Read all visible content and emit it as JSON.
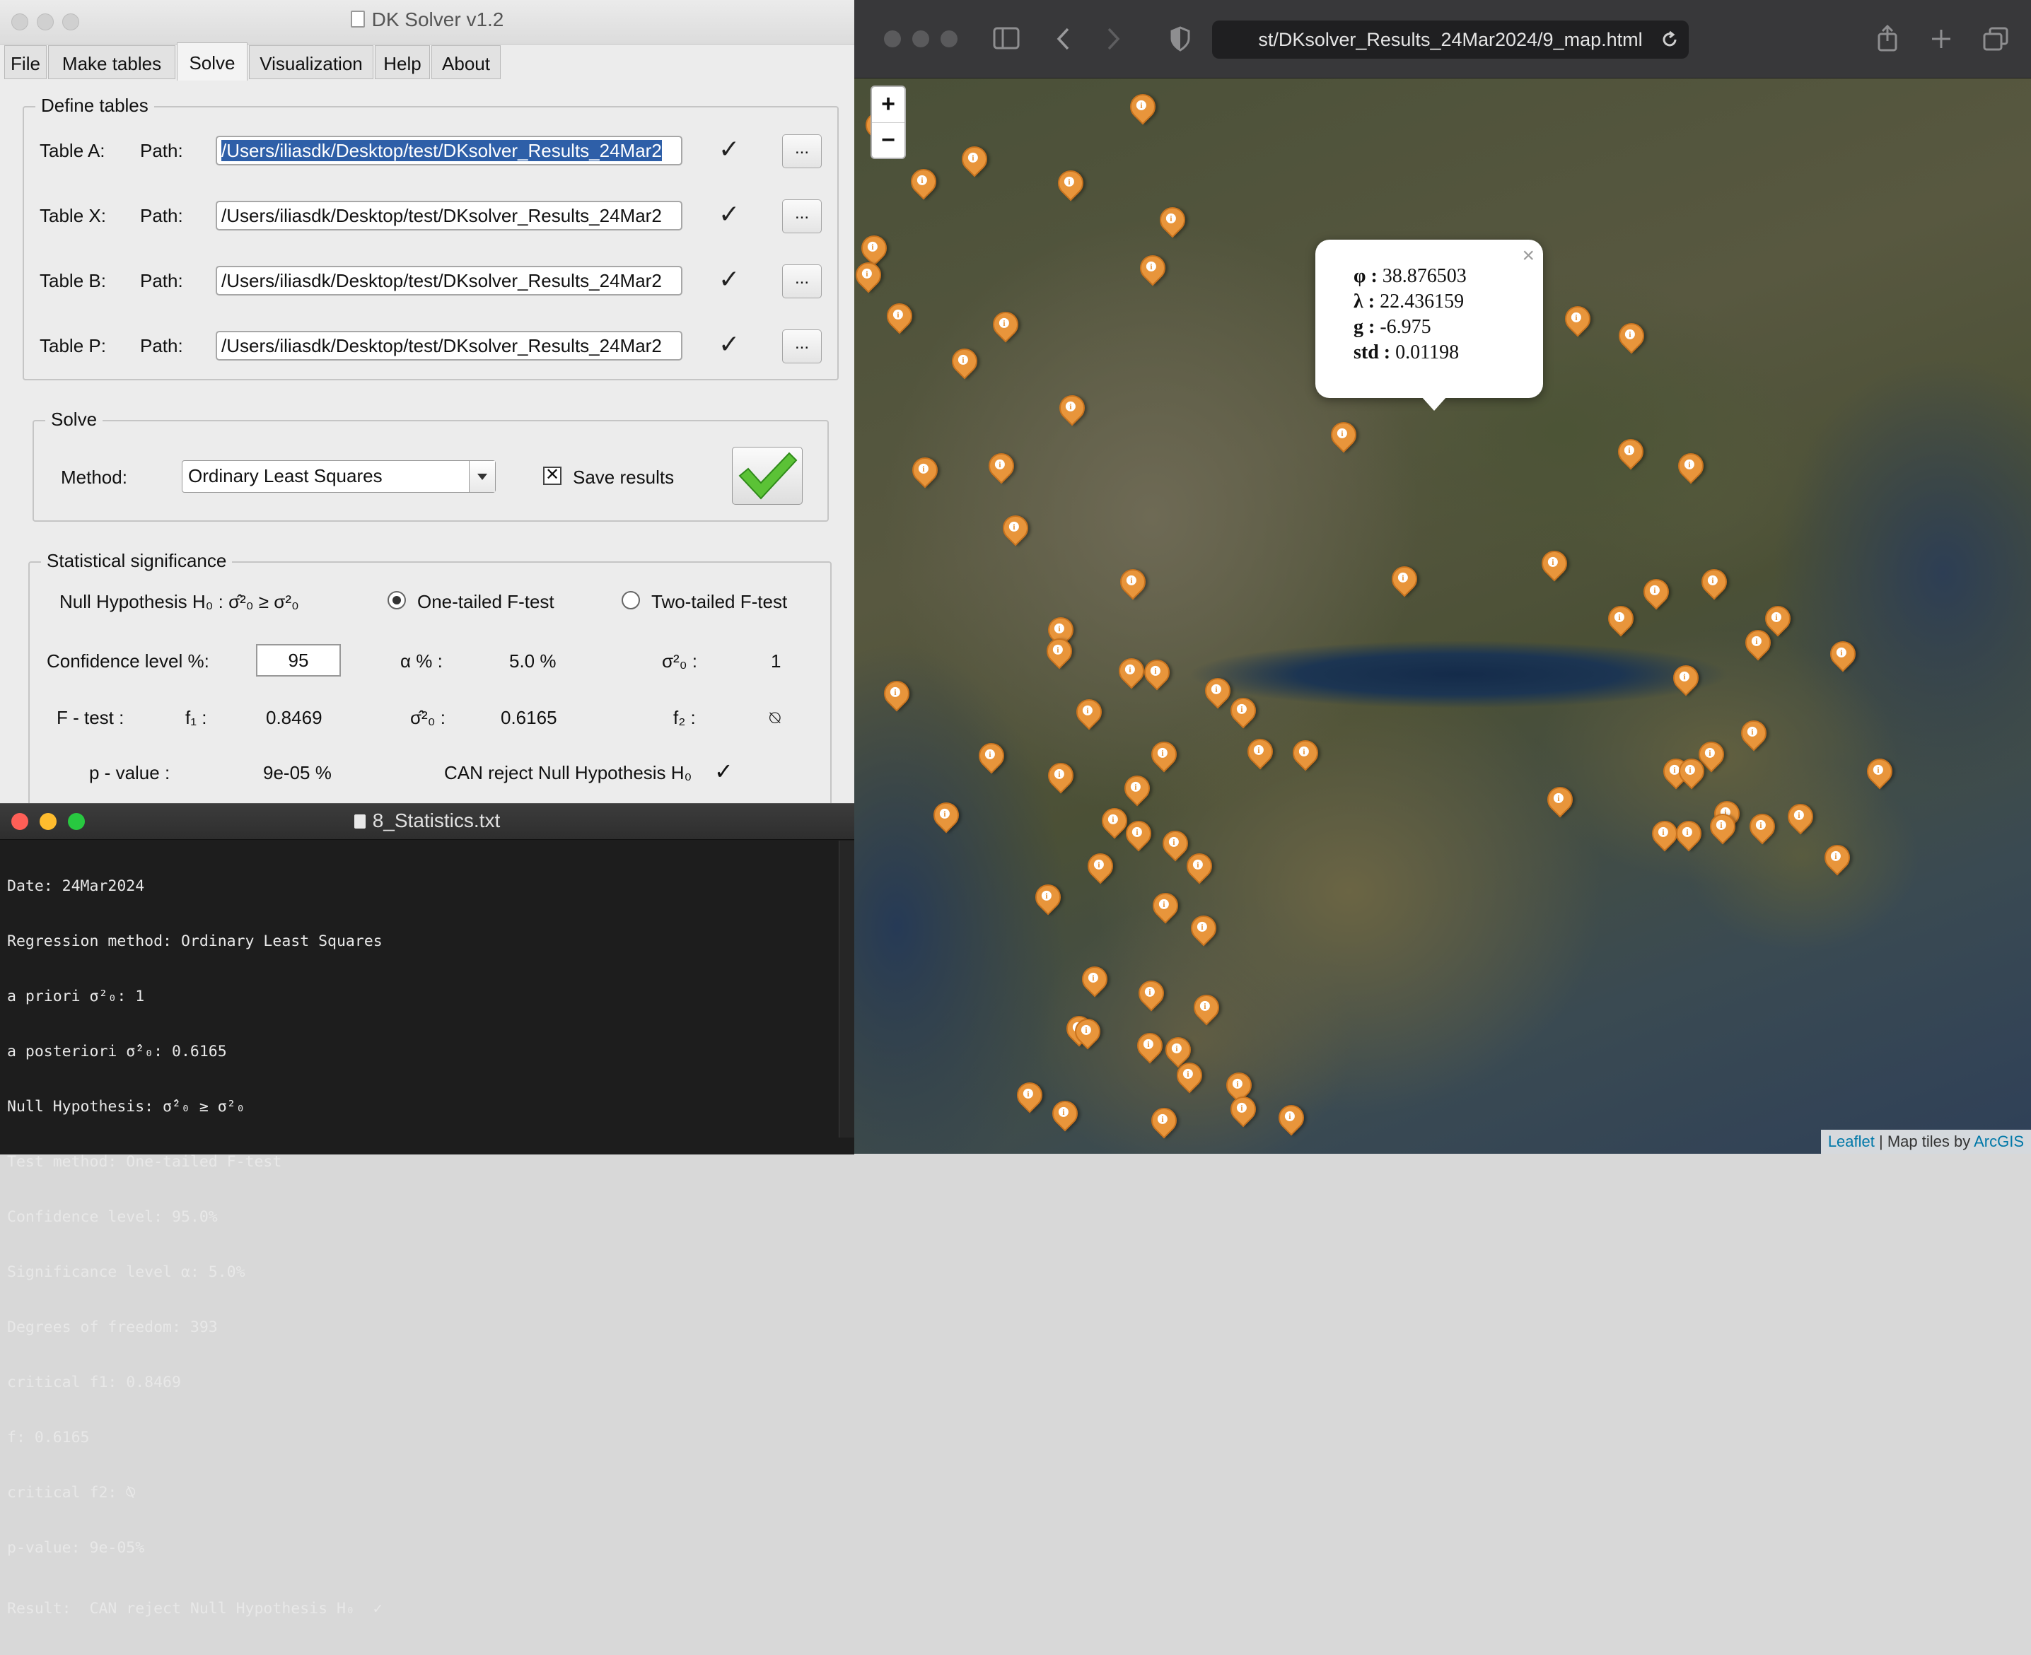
{
  "dk_window": {
    "title": "DK Solver v1.2",
    "tabs": [
      "File",
      "Make tables",
      "Solve",
      "Visualization",
      "Help",
      "About"
    ],
    "define_tables": {
      "title": "Define tables",
      "path_label": "Path:",
      "rows": [
        {
          "label": "Table A:",
          "path": "/Users/iliasdk/Desktop/test/DKsolver_Results_24Mar2"
        },
        {
          "label": "Table X:",
          "path": "/Users/iliasdk/Desktop/test/DKsolver_Results_24Mar2"
        },
        {
          "label": "Table B:",
          "path": "/Users/iliasdk/Desktop/test/DKsolver_Results_24Mar2"
        },
        {
          "label": "Table P:",
          "path": "/Users/iliasdk/Desktop/test/DKsolver_Results_24Mar2"
        }
      ],
      "check": "✓",
      "browse": "..."
    },
    "solve": {
      "title": "Solve",
      "method_label": "Method:",
      "method_value": "Ordinary Least Squares",
      "save_label": "Save results",
      "save_checked": true
    },
    "stats": {
      "title": "Statistical significance",
      "null_hypothesis": "Null Hypothesis  H₀ : σ̂²₀ ≥ σ²₀",
      "one_tailed": "One-tailed F-test",
      "two_tailed": "Two-tailed F-test",
      "confidence_label": "Confidence level %:",
      "confidence_value": "95",
      "alpha_label": "α % :",
      "alpha_value": "5.0 %",
      "sigma0_label": "σ²₀ :",
      "sigma0_value": "1",
      "ftest_label": "F - test :",
      "f1_label": "f₁ :",
      "f1_value": "0.8469",
      "sigma_hat_label": "σ̂²₀ :",
      "sigma_hat_value": "0.6165",
      "f2_label": "f₂ :",
      "f2_value": "⍉",
      "pvalue_label": "p - value :",
      "pvalue_value": "9e-05 %",
      "result": "CAN reject Null Hypothesis H₀",
      "result_check": "✓"
    }
  },
  "text_window": {
    "title": "8_Statistics.txt",
    "lines": [
      "Date: 24Mar2024",
      "Regression method: Ordinary Least Squares",
      "a priori σ²₀: 1",
      "a posteriori σ̂²₀: 0.6165",
      "Null Hypothesis: σ̂²₀ ≥ σ²₀",
      "Test method: One-tailed F-test",
      "Confidence level: 95.0%",
      "Significance level α: 5.0%",
      "Degrees of freedom: 393",
      "critical f1: 0.8469",
      "f: 0.6165",
      "critical f2: ⍉",
      "p-value: 9e-05%",
      "Result:  CAN reject Null Hypothesis H₀  ✓"
    ]
  },
  "browser": {
    "url": "st/DKsolver_Results_24Mar2024/9_map.html",
    "icons": [
      "sidebar-icon",
      "back-icon",
      "forward-icon",
      "shield-icon",
      "reload-icon",
      "share-icon",
      "new-tab-icon",
      "tabs-overview-icon"
    ],
    "zoom_in": "+",
    "zoom_out": "−",
    "popup": {
      "close": "×",
      "lines": [
        {
          "key": "φ :",
          "value": "38.876503"
        },
        {
          "key": "λ :",
          "value": "22.436159"
        },
        {
          "key": "g :",
          "value": "-6.975"
        },
        {
          "key": "std :",
          "value": "0.01198"
        }
      ]
    },
    "attribution": {
      "leaflet": "Leaflet",
      "sep": " | Map tiles by ",
      "arcgis": "ArcGIS"
    },
    "marker_icon": "info-marker-icon",
    "marker_color": "#e8953b"
  }
}
